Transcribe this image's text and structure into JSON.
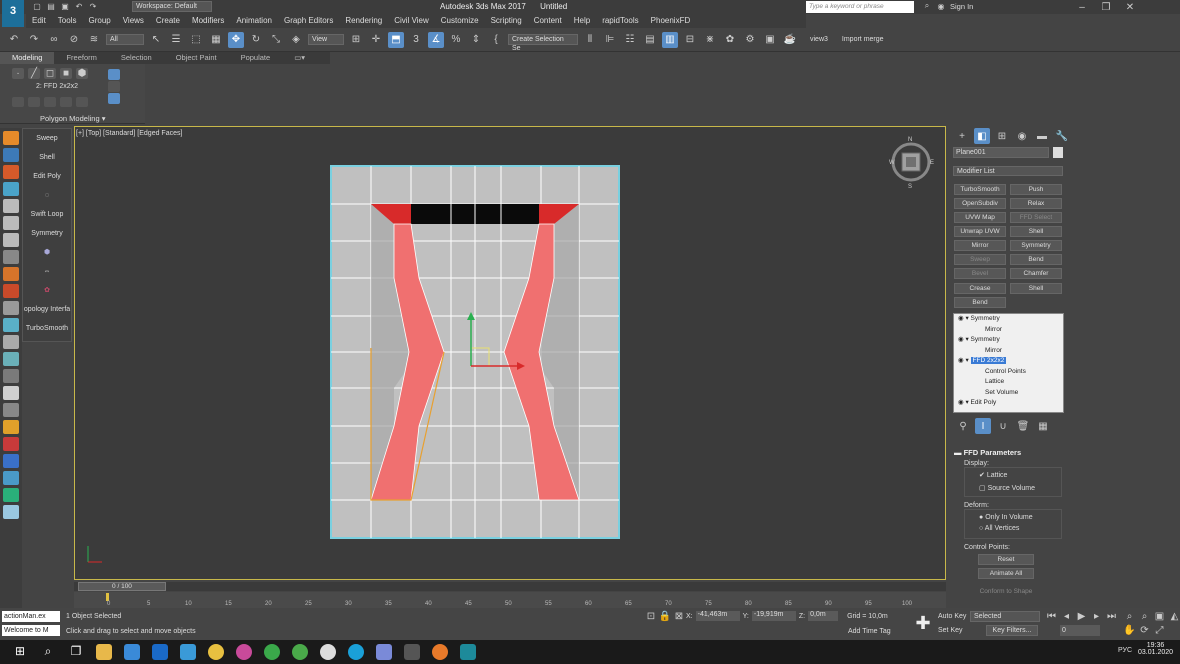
{
  "titlebar": {
    "workspace": "Workspace: Default",
    "app_title": "Autodesk 3ds Max 2017",
    "file_name": "Untitled",
    "search_placeholder": "Type a keyword or phrase",
    "sign_in": "Sign In"
  },
  "menu": [
    "Edit",
    "Tools",
    "Group",
    "Views",
    "Create",
    "Modifiers",
    "Animation",
    "Graph Editors",
    "Rendering",
    "Civil View",
    "Customize",
    "Scripting",
    "Content",
    "Help",
    "rapidTools",
    "PhoenixFD"
  ],
  "toolbar": {
    "filter": "All",
    "ref_coord": "View",
    "selection_set": "Create Selection Se",
    "view3": "view3",
    "import_merge": "Import merge"
  },
  "ribbon": {
    "tabs": [
      "Modeling",
      "Freeform",
      "Selection",
      "Object Paint",
      "Populate"
    ],
    "ffd_label": "2: FFD 2x2x2",
    "panel_label": "Polygon Modeling"
  },
  "left_panel": [
    "Sweep",
    "Shell",
    "Edit Poly",
    "Swift Loop",
    "Symmetry",
    "opology Interfa",
    "TurboSmooth"
  ],
  "viewport": {
    "label": "[+] [Top] [Standard] [Edged Faces]",
    "viewcube_n": "N",
    "viewcube_s": "S",
    "viewcube_w": "W",
    "viewcube_e": "E"
  },
  "command_panel": {
    "object_name": "Plane001",
    "modifier_list": "Modifier List",
    "buttons": [
      {
        "label": "TurboSmooth",
        "enabled": true
      },
      {
        "label": "Push",
        "enabled": true
      },
      {
        "label": "OpenSubdiv",
        "enabled": true
      },
      {
        "label": "Relax",
        "enabled": true
      },
      {
        "label": "UVW Map",
        "enabled": true
      },
      {
        "label": "FFD Select",
        "enabled": false
      },
      {
        "label": "Unwrap UVW",
        "enabled": true
      },
      {
        "label": "Shell",
        "enabled": true
      },
      {
        "label": "Mirror",
        "enabled": true
      },
      {
        "label": "Symmetry",
        "enabled": true
      },
      {
        "label": "Sweep",
        "enabled": false
      },
      {
        "label": "Bend",
        "enabled": true
      },
      {
        "label": "Bevel",
        "enabled": false
      },
      {
        "label": "Chamfer",
        "enabled": true
      },
      {
        "label": "Crease",
        "enabled": true
      },
      {
        "label": "Shell",
        "enabled": true
      },
      {
        "label": "Bend",
        "enabled": true
      }
    ],
    "stack": [
      {
        "label": "Symmetry",
        "level": 0,
        "selected": false
      },
      {
        "label": "Mirror",
        "level": 1,
        "selected": false
      },
      {
        "label": "Symmetry",
        "level": 0,
        "selected": false
      },
      {
        "label": "Mirror",
        "level": 1,
        "selected": false
      },
      {
        "label": "FFD 2x2x2",
        "level": 0,
        "selected": true
      },
      {
        "label": "Control Points",
        "level": 1,
        "selected": false
      },
      {
        "label": "Lattice",
        "level": 1,
        "selected": false
      },
      {
        "label": "Set Volume",
        "level": 1,
        "selected": false
      },
      {
        "label": "Edit Poly",
        "level": 0,
        "selected": false
      }
    ],
    "ffd": {
      "title": "FFD Parameters",
      "display_label": "Display:",
      "lattice": "Lattice",
      "source_volume": "Source Volume",
      "deform_label": "Deform:",
      "only_in_volume": "Only In Volume",
      "all_vertices": "All Vertices",
      "control_points_label": "Control Points:",
      "reset": "Reset",
      "animate_all": "Animate All",
      "conform": "Conform to Shape"
    }
  },
  "timeline": {
    "frame": "0 / 100",
    "ticks": [
      "0",
      "5",
      "10",
      "15",
      "20",
      "25",
      "30",
      "35",
      "40",
      "45",
      "50",
      "55",
      "60",
      "65",
      "70",
      "75",
      "80",
      "85",
      "90",
      "95",
      "100"
    ]
  },
  "status": {
    "script_box": "actionMan.ex",
    "listener": "Welcome to M",
    "selected": "1 Object Selected",
    "prompt": "Click and drag to select and move objects",
    "x_label": "X:",
    "x_value": "-41,463m",
    "y_label": "Y:",
    "y_value": "-19,919m",
    "z_label": "Z:",
    "z_value": "0,0m",
    "grid": "Grid = 10,0m",
    "add_time_tag": "Add Time Tag",
    "auto_key": "Auto Key",
    "set_key": "Set Key",
    "selected_dd": "Selected",
    "key_filters": "Key Filters...",
    "frame_field": "0"
  },
  "taskbar": {
    "lang": "РУС",
    "time": "19:36",
    "date": "03.01.2020"
  },
  "colors": {
    "accent": "#5a8fc8",
    "pink": "#f07070",
    "red_dark": "#d82a2a",
    "plane_border": "#7ad0e0",
    "selection_blue": "#3a7bd5"
  }
}
